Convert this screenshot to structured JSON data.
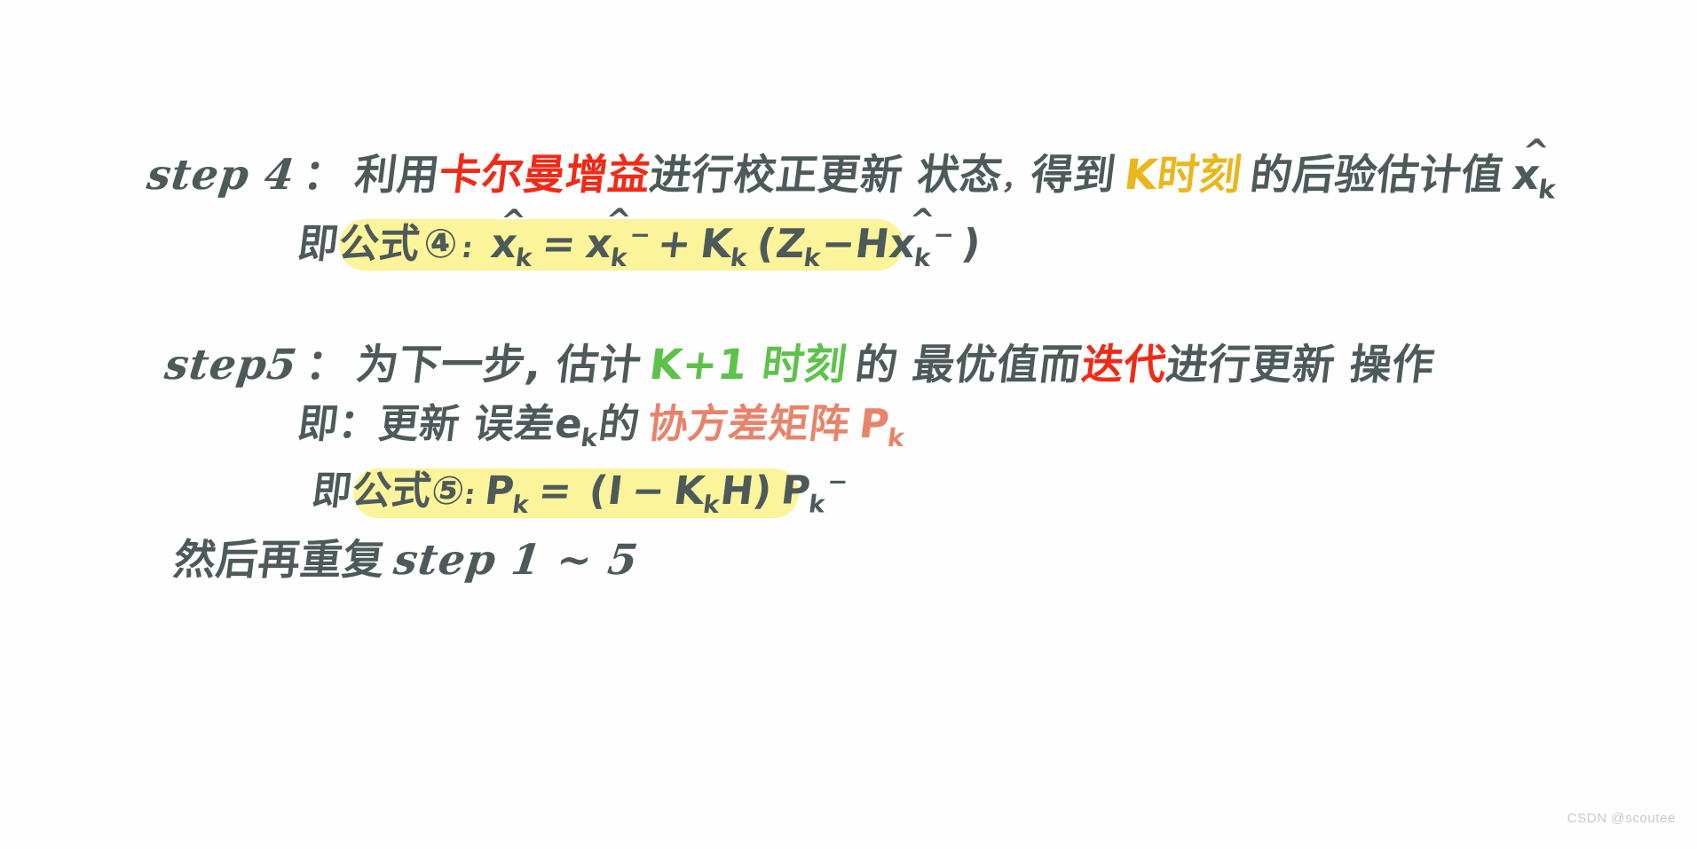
{
  "document": {
    "kind": "handwritten-note",
    "topic": "Kalman Filter steps 4 and 5",
    "background_color": "#fefefe",
    "ink_color": "#4e5a5a",
    "highlight_color": "#fbf49a",
    "accent_colors": {
      "red": "#ef2a17",
      "yellow": "#e8b71b",
      "green": "#5ec24a",
      "salmon": "#e8836b"
    }
  },
  "step4": {
    "label": "step 4",
    "colon": "：",
    "text_before_red": "利用",
    "red_term": "卡尔曼增益",
    "text_after_red": "进行校正更新 状态",
    "comma": "，",
    "text_before_yellow": "得到",
    "yellow_term": "K时刻",
    "text_after_yellow": "的后验估计值",
    "result_symbol": {
      "base": "x",
      "hat": "^",
      "subscript": "k"
    }
  },
  "formula4": {
    "prefix": "即",
    "label": "公式",
    "number": "④",
    "colon": ":",
    "lhs": {
      "base": "x",
      "hat": "^",
      "subscript": "k",
      "superscript": ""
    },
    "equals": "=",
    "term1": {
      "base": "x",
      "hat": "^",
      "subscript": "k",
      "superscript": "−"
    },
    "plus": "+",
    "gain": {
      "base": "K",
      "subscript": "k"
    },
    "open_paren": "(",
    "measurement": {
      "base": "Z",
      "subscript": "k"
    },
    "minus": "−",
    "observation_matrix": "H",
    "prior": {
      "base": "x",
      "hat": "^",
      "subscript": "k",
      "superscript": "−"
    },
    "close_paren": ")",
    "plain_text": "x̂k = x̂k⁻ + Kk ( Zk − H x̂k⁻ )"
  },
  "step5": {
    "label": "step5",
    "colon": "：",
    "text_1": "为下一步, 估计",
    "green_term": "K+1 时刻",
    "text_2": "的 最优值而",
    "red_term": "迭代",
    "text_3": "进行更新 操作"
  },
  "step5_detail": {
    "prefix": "即：更新 误差",
    "error_symbol": {
      "base": "e",
      "subscript": "k"
    },
    "middle": "的",
    "salmon_term": "协方差矩阵",
    "covariance_symbol": {
      "base": "P",
      "subscript": "k"
    }
  },
  "formula5": {
    "prefix": "即",
    "label": "公式",
    "number": "⑤",
    "colon": ":",
    "lhs": {
      "base": "P",
      "subscript": "k"
    },
    "equals": "=",
    "open_paren": "(",
    "identity": "I",
    "minus": "−",
    "gain": {
      "base": "K",
      "subscript": "k"
    },
    "observation_matrix": "H",
    "close_paren": ")",
    "rhs": {
      "base": "P",
      "subscript": "k",
      "superscript": "−"
    },
    "plain_text": "Pk = ( I − KkH ) Pk⁻"
  },
  "closing": {
    "text_cn": "然后再重复",
    "text_latin": "step 1 ~ 5"
  },
  "watermark": {
    "text": "CSDN @scoutee"
  }
}
